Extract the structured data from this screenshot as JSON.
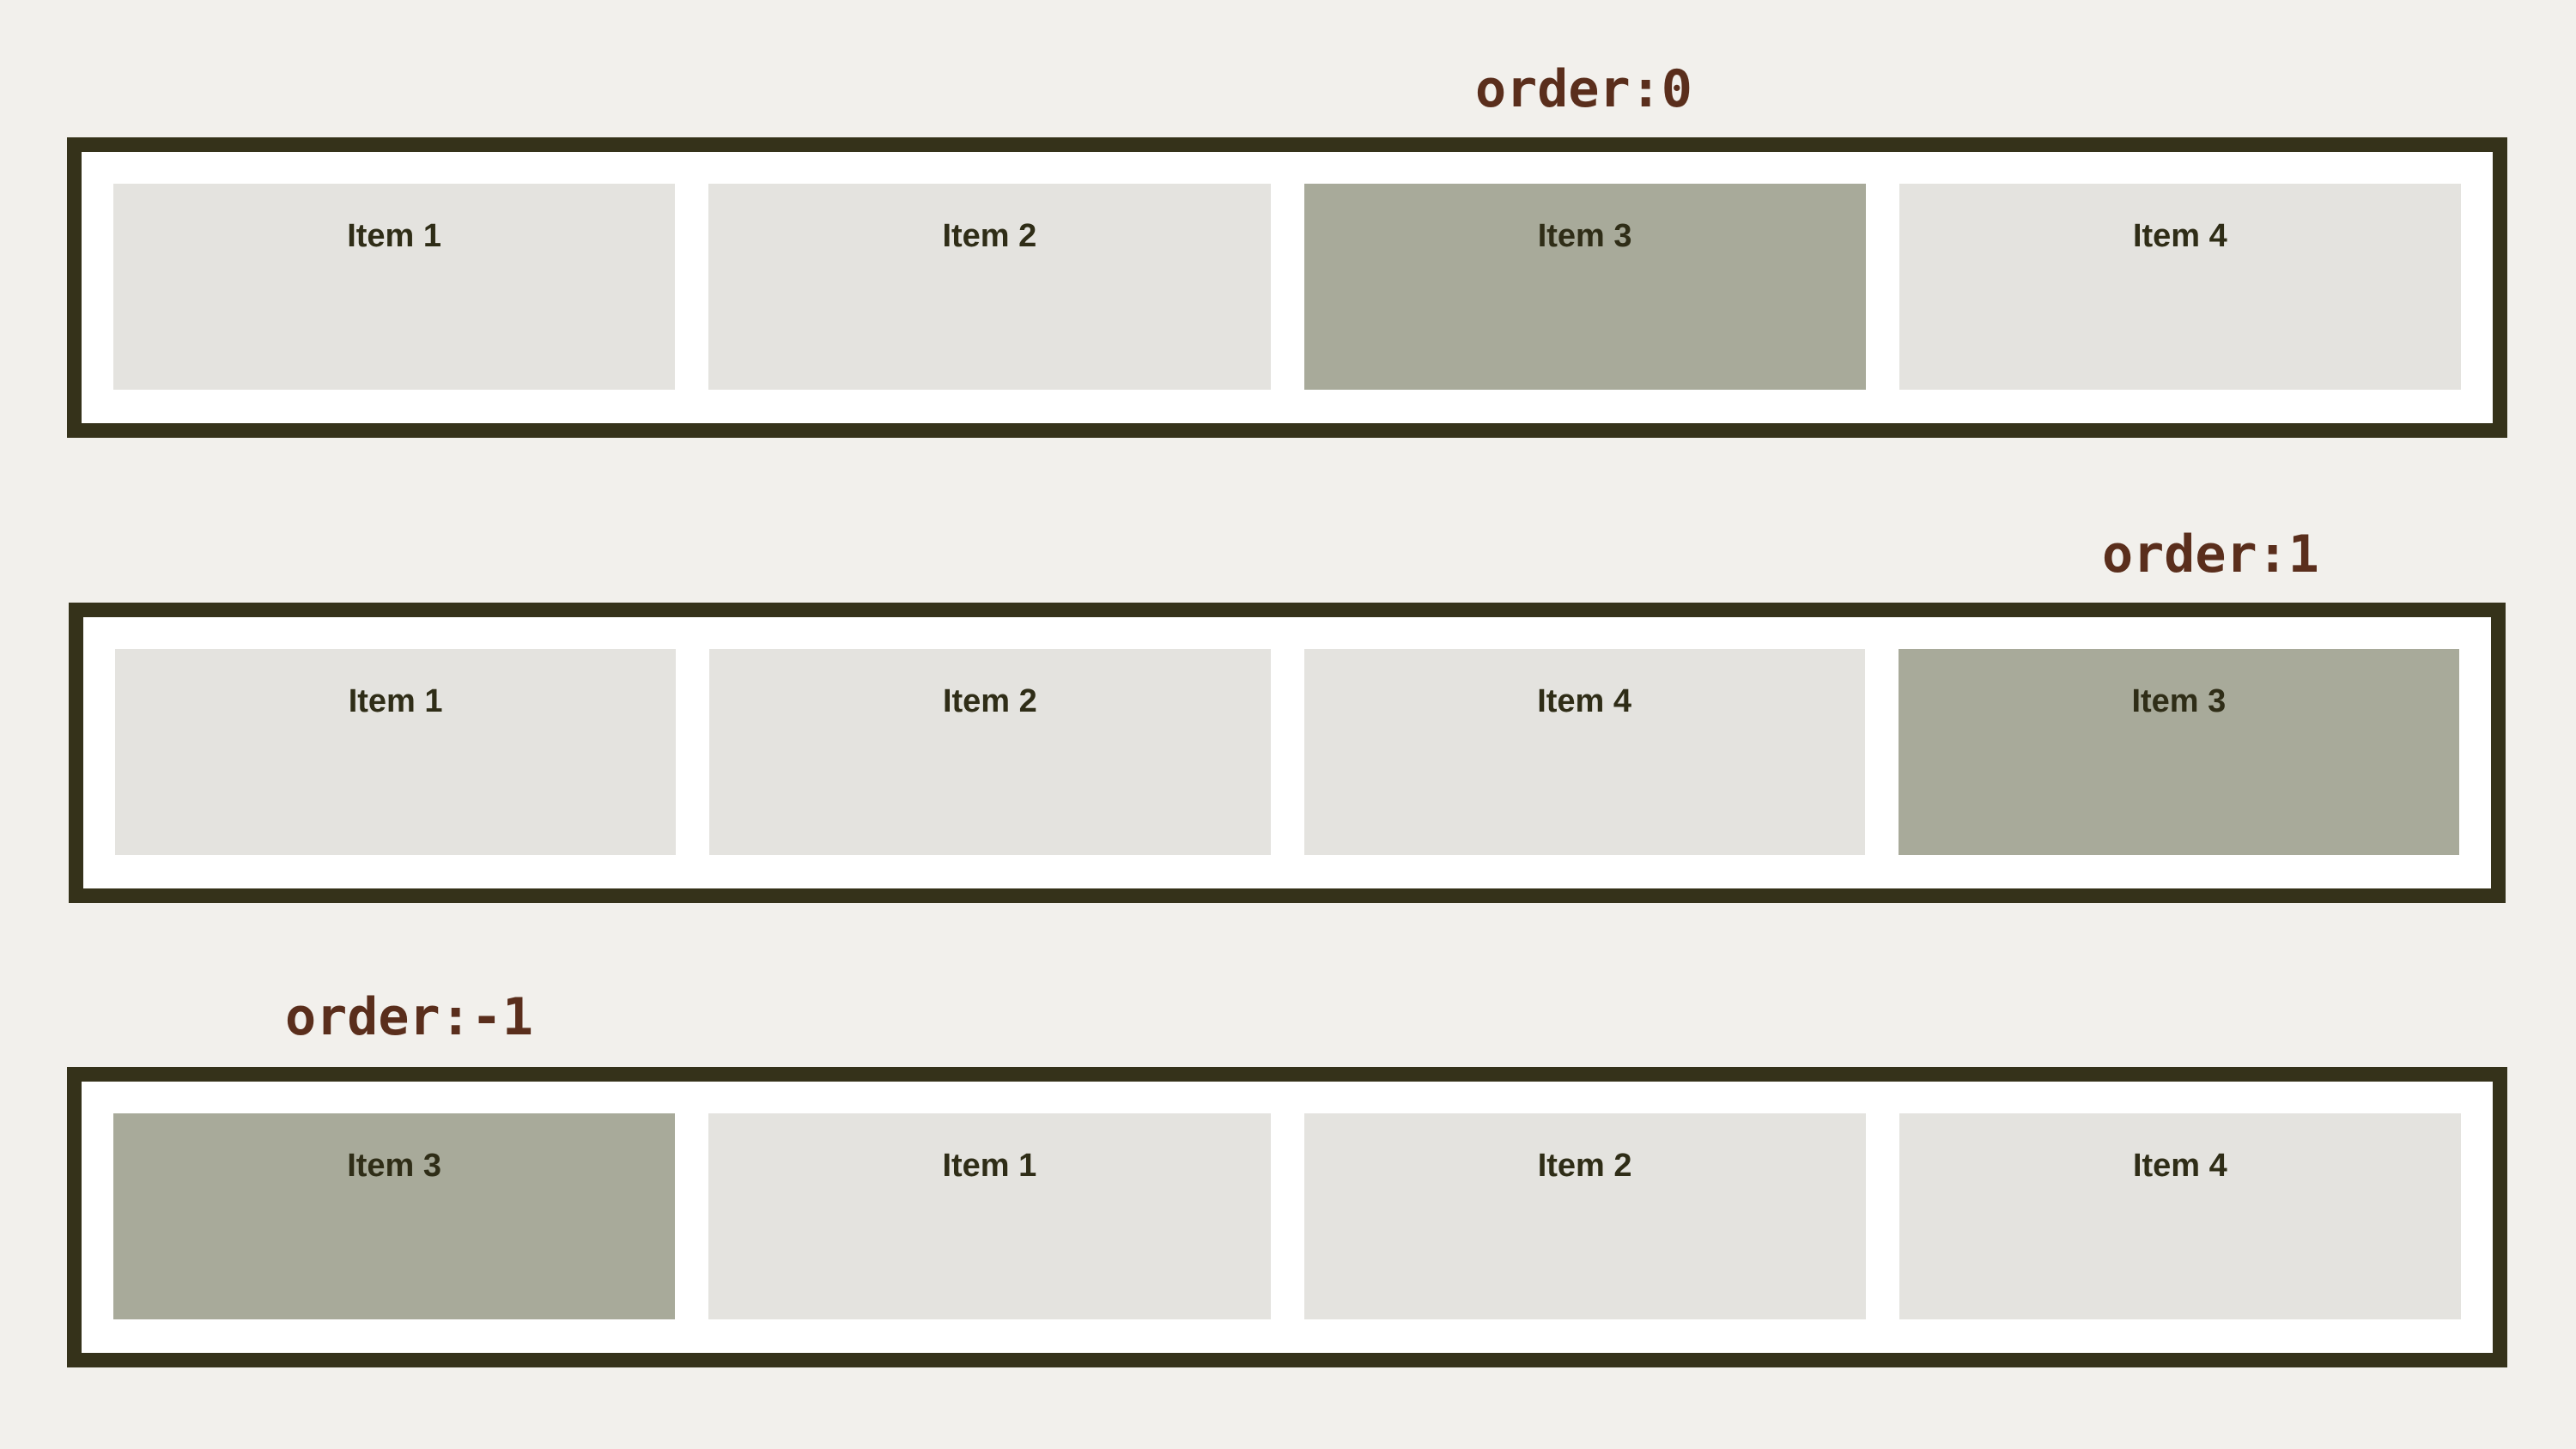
{
  "colors": {
    "page_background": "#f2f0ec",
    "container_border": "#35321a",
    "container_fill": "#ffffff",
    "item_default": "#e4e3df",
    "item_highlight": "#a8aa9a",
    "item_text": "#2f2d17",
    "label_text": "#5a2e1c"
  },
  "rows": [
    {
      "label": "order:0",
      "items": [
        {
          "text": "Item 1",
          "highlight": false
        },
        {
          "text": "Item 2",
          "highlight": false
        },
        {
          "text": "Item 3",
          "highlight": true
        },
        {
          "text": "Item 4",
          "highlight": false
        }
      ]
    },
    {
      "label": "order:1",
      "items": [
        {
          "text": "Item 1",
          "highlight": false
        },
        {
          "text": "Item 2",
          "highlight": false
        },
        {
          "text": "Item 4",
          "highlight": false
        },
        {
          "text": "Item 3",
          "highlight": true
        }
      ]
    },
    {
      "label": "order:-1",
      "items": [
        {
          "text": "Item 3",
          "highlight": true
        },
        {
          "text": "Item 1",
          "highlight": false
        },
        {
          "text": "Item 2",
          "highlight": false
        },
        {
          "text": "Item 4",
          "highlight": false
        }
      ]
    }
  ]
}
